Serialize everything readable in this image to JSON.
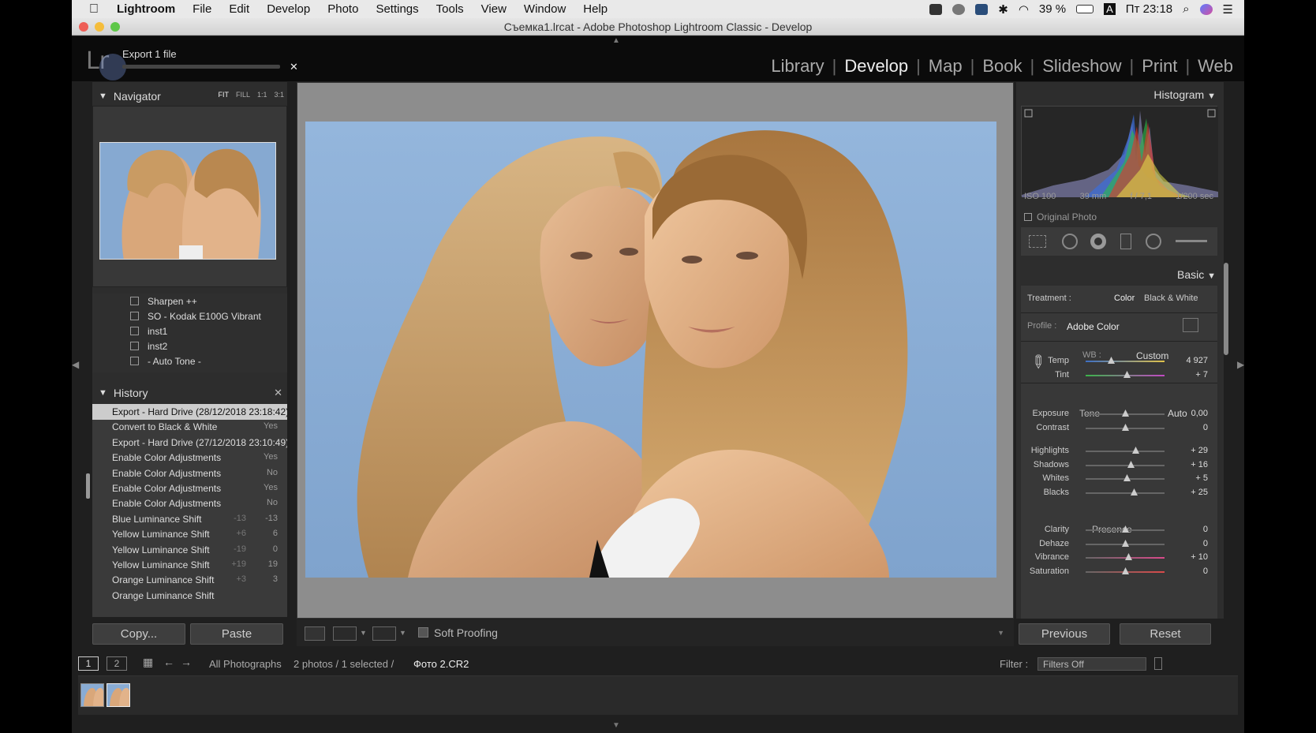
{
  "menubar": {
    "app": "Lightroom",
    "items": [
      "File",
      "Edit",
      "Develop",
      "Photo",
      "Settings",
      "Tools",
      "View",
      "Window",
      "Help"
    ],
    "battery": "39 %",
    "input_source": "A",
    "clock": "Пт 23:18"
  },
  "window": {
    "title": "Съемка1.lrcat - Adobe Photoshop Lightroom Classic - Develop"
  },
  "topbar": {
    "logo": "Lr",
    "export_text": "Export 1 file",
    "export_cancel": "✕",
    "modules": [
      "Library",
      "Develop",
      "Map",
      "Book",
      "Slideshow",
      "Print",
      "Web"
    ],
    "active_module": "Develop"
  },
  "navigator": {
    "title": "Navigator",
    "modes": [
      "FIT",
      "FILL",
      "1:1",
      "3:1"
    ]
  },
  "presets": [
    {
      "label": "Sharpen ++"
    },
    {
      "label": "SO - Kodak E100G Vibrant"
    },
    {
      "label": "inst1"
    },
    {
      "label": "inst2"
    },
    {
      "label": "- Auto Tone -"
    }
  ],
  "history": {
    "title": "History",
    "close": "✕",
    "rows": [
      {
        "name": "Export - Hard Drive (28/12/2018 23:18:42)",
        "v1": "",
        "v2": "",
        "selected": true
      },
      {
        "name": "Convert to Black & White",
        "v1": "",
        "v2": "Yes"
      },
      {
        "name": "Export - Hard Drive (27/12/2018 23:10:49)",
        "v1": "",
        "v2": ""
      },
      {
        "name": "Enable Color Adjustments",
        "v1": "",
        "v2": "Yes"
      },
      {
        "name": "Enable Color Adjustments",
        "v1": "",
        "v2": "No"
      },
      {
        "name": "Enable Color Adjustments",
        "v1": "",
        "v2": "Yes"
      },
      {
        "name": "Enable Color Adjustments",
        "v1": "",
        "v2": "No"
      },
      {
        "name": "Blue Luminance Shift",
        "v1": "-13",
        "v2": "-13"
      },
      {
        "name": "Yellow Luminance Shift",
        "v1": "+6",
        "v2": "6"
      },
      {
        "name": "Yellow Luminance Shift",
        "v1": "-19",
        "v2": "0"
      },
      {
        "name": "Yellow Luminance Shift",
        "v1": "+19",
        "v2": "19"
      },
      {
        "name": "Orange Luminance Shift",
        "v1": "+3",
        "v2": "3"
      },
      {
        "name": "Orange Luminance Shift",
        "v1": "",
        "v2": ""
      }
    ]
  },
  "left_buttons": {
    "copy": "Copy...",
    "paste": "Paste"
  },
  "toolbar": {
    "soft_proofing": "Soft Proofing"
  },
  "histogram": {
    "title": "Histogram",
    "iso": "ISO 100",
    "focal": "39 mm",
    "aperture": "f / 7,1",
    "shutter": "1/200 sec",
    "original_photo": "Original Photo"
  },
  "basic": {
    "title": "Basic",
    "treatment_label": "Treatment :",
    "treatment_color": "Color",
    "treatment_bw": "Black & White",
    "profile_label": "Profile :",
    "profile_value": "Adobe Color",
    "wb_label": "WB :",
    "wb_value": "Custom",
    "tone_label": "Tone",
    "auto_label": "Auto",
    "presence_label": "Presence",
    "sliders": [
      {
        "label": "Temp",
        "value": "4 927",
        "pos": 0.32
      },
      {
        "label": "Tint",
        "value": "+ 7",
        "pos": 0.52
      },
      {
        "label": "Exposure",
        "value": "0,00",
        "pos": 0.5
      },
      {
        "label": "Contrast",
        "value": "0",
        "pos": 0.5
      },
      {
        "label": "Highlights",
        "value": "+ 29",
        "pos": 0.63
      },
      {
        "label": "Shadows",
        "value": "+ 16",
        "pos": 0.57
      },
      {
        "label": "Whites",
        "value": "+ 5",
        "pos": 0.52
      },
      {
        "label": "Blacks",
        "value": "+ 25",
        "pos": 0.61
      },
      {
        "label": "Clarity",
        "value": "0",
        "pos": 0.5
      },
      {
        "label": "Dehaze",
        "value": "0",
        "pos": 0.5
      },
      {
        "label": "Vibrance",
        "value": "+ 10",
        "pos": 0.54
      },
      {
        "label": "Saturation",
        "value": "0",
        "pos": 0.5
      }
    ]
  },
  "right_buttons": {
    "previous": "Previous",
    "reset": "Reset"
  },
  "filmbar": {
    "page1": "1",
    "page2": "2",
    "source": "All Photographs",
    "selection": "2 photos / 1 selected /",
    "filename": "Фото 2.CR2",
    "filter_label": "Filter :",
    "filter_value": "Filters Off"
  },
  "colors": {
    "accent": "#cccccc",
    "panel": "#383838",
    "background": "#1f1f1f"
  }
}
